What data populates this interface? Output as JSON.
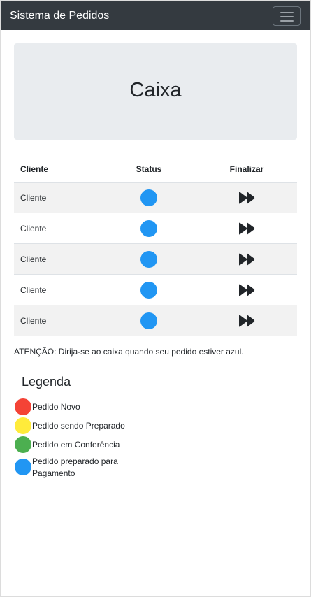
{
  "navbar": {
    "brand": "Sistema de Pedidos",
    "toggle_icon": "menu-icon"
  },
  "header": {
    "title": "Caixa"
  },
  "table": {
    "columns": [
      "Cliente",
      "Status",
      "Finalizar"
    ],
    "rows": [
      {
        "client": "Cliente",
        "status_color": "#2196f3",
        "finalize_icon": "fast-forward-icon"
      },
      {
        "client": "Cliente",
        "status_color": "#2196f3",
        "finalize_icon": "fast-forward-icon"
      },
      {
        "client": "Cliente",
        "status_color": "#2196f3",
        "finalize_icon": "fast-forward-icon"
      },
      {
        "client": "Cliente",
        "status_color": "#2196f3",
        "finalize_icon": "fast-forward-icon"
      },
      {
        "client": "Cliente",
        "status_color": "#2196f3",
        "finalize_icon": "fast-forward-icon"
      }
    ]
  },
  "warning": "ATENÇÃO: Dirija-se ao caixa quando seu pedido estiver azul.",
  "legend": {
    "title": "Legenda",
    "items": [
      {
        "label": "Pedido Novo",
        "color": "#f44336"
      },
      {
        "label": "Pedido sendo Preparado",
        "color": "#ffeb3b"
      },
      {
        "label": "Pedido em Conferência",
        "color": "#4caf50"
      },
      {
        "label": "Pedido preparado para Pagamento",
        "color": "#2196f3"
      }
    ]
  }
}
